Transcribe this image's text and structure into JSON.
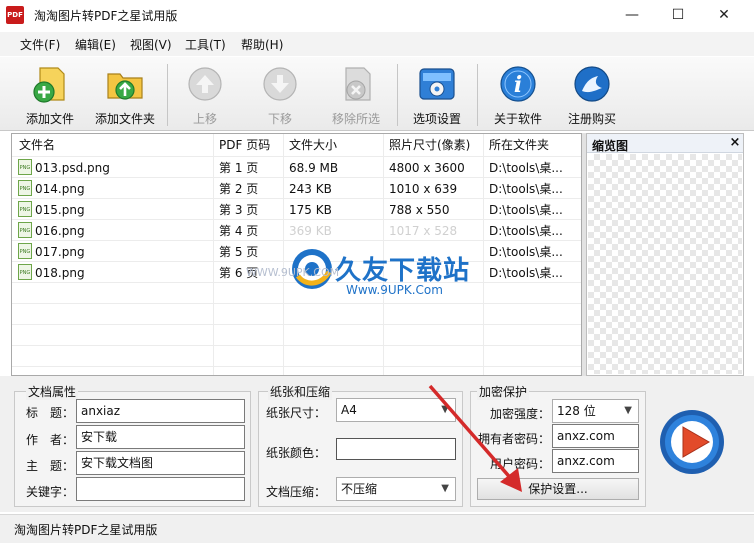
{
  "window": {
    "title": "淘淘图片转PDF之星试用版",
    "app_icon_text": "PDF",
    "controls": {
      "minimize": "—",
      "maximize": "☐",
      "close": "✕"
    }
  },
  "menu": [
    "文件(F)",
    "编辑(E)",
    "视图(V)",
    "工具(T)",
    "帮助(H)"
  ],
  "toolbar": [
    {
      "label": "添加文件",
      "icon": "add-file-icon",
      "enabled": true
    },
    {
      "label": "添加文件夹",
      "icon": "add-folder-icon",
      "enabled": true
    },
    {
      "label": "上移",
      "icon": "arrow-up-icon",
      "enabled": false
    },
    {
      "label": "下移",
      "icon": "arrow-down-icon",
      "enabled": false
    },
    {
      "label": "移除所选",
      "icon": "remove-icon",
      "enabled": false
    },
    {
      "label": "选项设置",
      "icon": "settings-icon",
      "enabled": true
    },
    {
      "label": "关于软件",
      "icon": "info-icon",
      "enabled": true
    },
    {
      "label": "注册购买",
      "icon": "register-icon",
      "enabled": true
    }
  ],
  "file_list": {
    "columns": [
      "文件名",
      "PDF 页码",
      "文件大小",
      "照片尺寸(像素)",
      "所在文件夹"
    ],
    "rows": [
      {
        "name": "013.psd.png",
        "page": "第 1 页",
        "size": "68.9 MB",
        "dims": "4800 x 3600",
        "folder": "D:\\tools\\桌..."
      },
      {
        "name": "014.png",
        "page": "第 2 页",
        "size": "243 KB",
        "dims": "1010 x 639",
        "folder": "D:\\tools\\桌..."
      },
      {
        "name": "015.png",
        "page": "第 3 页",
        "size": "175 KB",
        "dims": "788 x 550",
        "folder": "D:\\tools\\桌..."
      },
      {
        "name": "016.png",
        "page": "第 4 页",
        "size": "369 KB",
        "dims": "1017 x 528",
        "folder": "D:\\tools\\桌..."
      },
      {
        "name": "017.png",
        "page": "第 5 页",
        "size": "",
        "dims": "",
        "folder": "D:\\tools\\桌..."
      },
      {
        "name": "018.png",
        "page": "第 6 页",
        "size": "",
        "dims": "",
        "folder": "D:\\tools\\桌..."
      }
    ],
    "file_icon_text": "PNG"
  },
  "preview": {
    "title": "缩览图",
    "close": "×"
  },
  "doc_props": {
    "title": "文档属性",
    "title_label": "标　题：",
    "title_value": "anxiaz",
    "author_label": "作　者：",
    "author_value": "安下载",
    "subject_label": "主　题：",
    "subject_value": "安下载文档图",
    "keywords_label": "关键字：",
    "keywords_value": ""
  },
  "paper": {
    "title": "纸张和压缩",
    "size_label": "纸张尺寸：",
    "size_value": "A4",
    "color_label": "纸张颜色：",
    "compress_label": "文档压缩：",
    "compress_value": "不压缩"
  },
  "encrypt": {
    "title": "加密保护",
    "strength_label": "加密强度：",
    "strength_value": "128 位",
    "owner_label": "拥有者密码：",
    "owner_value": "anxz.com",
    "user_label": "用户密码：",
    "user_value": "anxz.com",
    "button": "保护设置..."
  },
  "status": "淘淘图片转PDF之星试用版",
  "watermark": {
    "cn": "久友下载站",
    "url": "Www.9UPK.Com",
    "small": "WWW.9UPK.COM"
  },
  "colors": {
    "accent": "#1e72c8",
    "arrow": "#d42a2a"
  }
}
